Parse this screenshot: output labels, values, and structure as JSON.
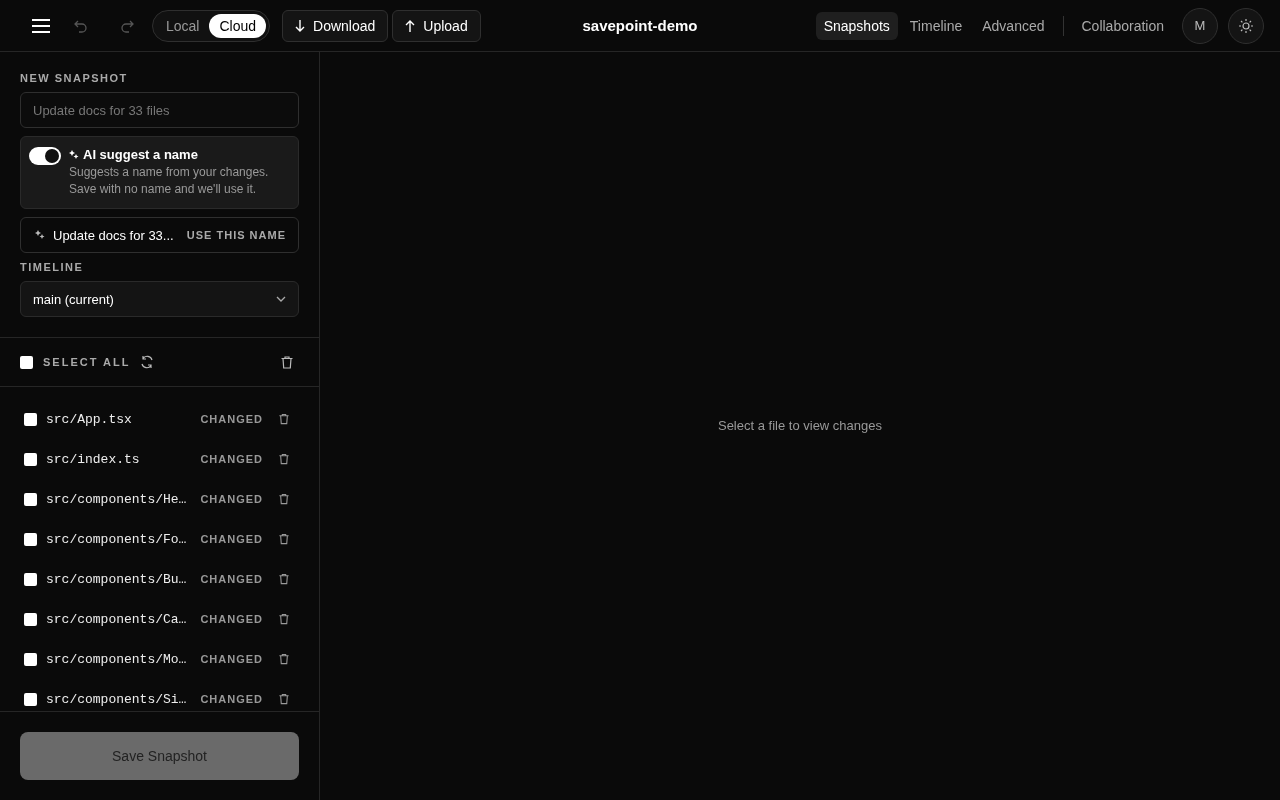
{
  "toolbar": {
    "storage": [
      {
        "label": "Local",
        "selected": false
      },
      {
        "label": "Cloud",
        "selected": true
      }
    ],
    "actions": [
      {
        "label": "Download",
        "kind": "down"
      },
      {
        "label": "Upload",
        "kind": "up"
      }
    ]
  },
  "title": "savepoint-demo",
  "nav": [
    {
      "label": "Snapshots",
      "selected": true
    },
    {
      "label": "Timeline",
      "selected": false
    },
    {
      "label": "Advanced",
      "selected": false
    }
  ],
  "collaboration": "Collaboration",
  "avatar": "M",
  "sidebar": {
    "section_label": "NEW SNAPSHOT",
    "name_placeholder": "Update docs for 33 files",
    "ai": {
      "on": true,
      "title": "AI suggest a name",
      "description": "Suggests a name from your changes. Save with no name and we'll use it."
    },
    "suggestion": {
      "text": "Update docs for 33...",
      "action": "USE THIS NAME"
    },
    "timeline_label": "TIMELINE",
    "timeline_value": "main (current)",
    "select_all": {
      "label": "SELECT ALL",
      "checked": false
    },
    "files": [
      {
        "path": "src/App.tsx",
        "status": "CHANGED",
        "checked": false
      },
      {
        "path": "src/index.ts",
        "status": "CHANGED",
        "checked": false
      },
      {
        "path": "src/components/He…",
        "status": "CHANGED",
        "checked": false
      },
      {
        "path": "src/components/Fo…",
        "status": "CHANGED",
        "checked": false
      },
      {
        "path": "src/components/Bu…",
        "status": "CHANGED",
        "checked": false
      },
      {
        "path": "src/components/Ca…",
        "status": "CHANGED",
        "checked": false
      },
      {
        "path": "src/components/Mo…",
        "status": "CHANGED",
        "checked": false
      },
      {
        "path": "src/components/Si…",
        "status": "CHANGED",
        "checked": false
      }
    ],
    "save_button": {
      "label": "Save Snapshot",
      "disabled": true
    }
  },
  "main": {
    "empty_message": "Select a file to view changes"
  }
}
